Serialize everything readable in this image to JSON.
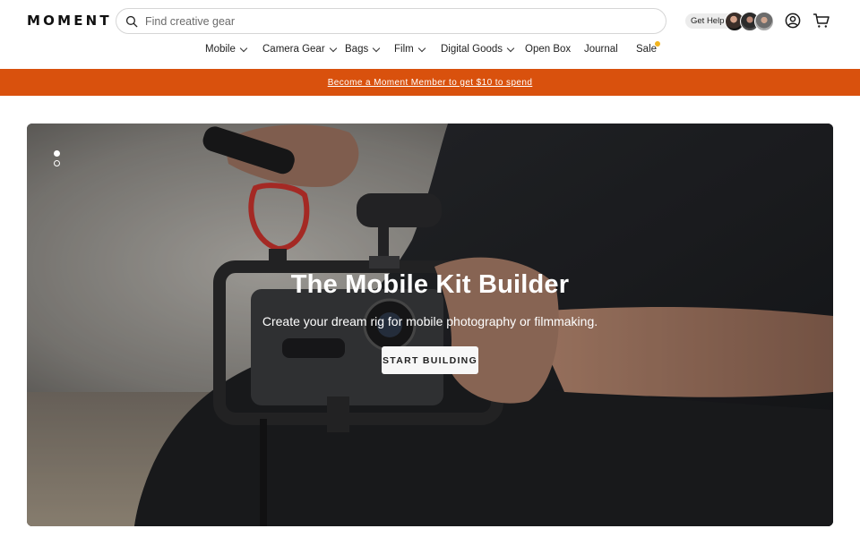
{
  "brand": {
    "logo": "MOMENT"
  },
  "search": {
    "placeholder": "Find creative gear"
  },
  "header": {
    "get_help": "Get Help"
  },
  "nav": {
    "items": [
      {
        "label": "Mobile",
        "dropdown": true
      },
      {
        "label": "Camera Gear",
        "dropdown": true
      },
      {
        "label": "Bags",
        "dropdown": true
      },
      {
        "label": "Film",
        "dropdown": true
      },
      {
        "label": "Digital Goods",
        "dropdown": true
      },
      {
        "label": "Open Box",
        "dropdown": false
      },
      {
        "label": "Journal",
        "dropdown": false
      },
      {
        "label": "Sale",
        "dropdown": false,
        "badge": "new-dot"
      }
    ]
  },
  "promo": {
    "text": "Become a Moment Member to get $10 to spend",
    "color": "#d9510d"
  },
  "hero": {
    "title": "The Mobile Kit Builder",
    "subtitle": "Create your dream rig for mobile photography or filmmaking.",
    "cta": "START BUILDING",
    "slides": 2,
    "active_slide": 1
  },
  "icons": [
    "search-icon",
    "account-icon",
    "cart-icon",
    "chevron-down-icon"
  ],
  "colors": {
    "accent": "#d9510d",
    "sale_dot": "#f2b41e"
  }
}
